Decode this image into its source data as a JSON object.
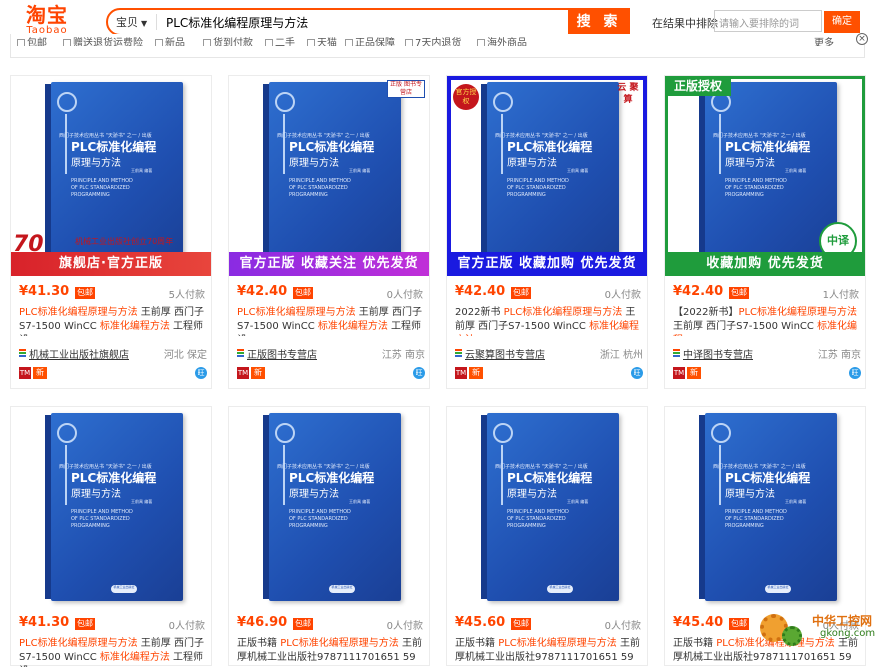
{
  "header": {
    "logo_zh": "淘宝",
    "logo_en": "Taobao",
    "search_category": "宝贝",
    "search_query": "PLC标准化编程原理与方法",
    "search_button": "搜 索",
    "exclude_label": "在结果中排除",
    "exclude_placeholder": "请输入要排除的词",
    "exclude_button": "确定",
    "close_symbol": "×"
  },
  "filters": {
    "items": [
      "包邮",
      "赠送退货运费险",
      "新品",
      "货到付款",
      "二手",
      "天猫",
      "正品保障",
      "7天内退货",
      "海外商品"
    ],
    "more": "更多"
  },
  "book": {
    "series": "西门子技术应用丛书 \"天骄书\" 之一 / 出版",
    "title": "PLC标准化编程",
    "subtitle": "原理与方法",
    "en_1": "PRINCIPLE AND METHOD",
    "en_2": "OF PLC STANDARDIZED",
    "en_3": "PROGRAMMING",
    "author": "王前禹 编著",
    "publisher": "机械工业出版社"
  },
  "products": [
    {
      "banner": "旗舰店·官方正版",
      "badge": "70",
      "badge_note": "机械工业出版社创立70周年",
      "price": "¥41.30",
      "baoyou": "包邮",
      "paid": "5人付款",
      "title_pre": "",
      "title_hl": "PLC标准化编程原理与方法",
      "title_mid": " 王前厚 西门子S7-1500 WinCC ",
      "title_hl2": "标准化编程方法",
      "title_post": " 工程师设",
      "shop": "机械工业出版社旗舰店",
      "location": "河北 保定",
      "tm": "TM",
      "new": "新",
      "ww": "旺"
    },
    {
      "banner": "官方正版 收藏关注 优先发货",
      "stamp": "正版 图书专营店",
      "price": "¥42.40",
      "baoyou": "包邮",
      "paid": "0人付款",
      "title_pre": "",
      "title_hl": "PLC标准化编程原理与方法",
      "title_mid": " 王前厚 西门子S7-1500 WinCC ",
      "title_hl2": "标准化编程方法",
      "title_post": " 工程师设",
      "shop": "正版图书专营店",
      "location": "江苏 南京",
      "tm": "TM",
      "new": "新",
      "ww": "旺"
    },
    {
      "banner": "官方正版 收藏加购 优先发货",
      "ribbon_left": "官方授权",
      "ribbon_right": "云 聚算",
      "price": "¥42.40",
      "baoyou": "包邮",
      "paid": "0人付款",
      "title_pre": "2022新书 ",
      "title_hl": "PLC标准化编程原理与方法",
      "title_mid": " 王前厚 西门子S7-1500 WinCC ",
      "title_hl2": "标准化编程方法",
      "title_post": "",
      "shop": "云聚算图书专营店",
      "location": "浙江 杭州",
      "tm": "TM",
      "new": "新",
      "ww": "旺"
    },
    {
      "banner": "收藏加购 优先发货",
      "tag": "正版授权",
      "seal": "中译",
      "price": "¥42.40",
      "baoyou": "包邮",
      "paid": "1人付款",
      "title_pre": "【2022新书】",
      "title_hl": "PLC标准化编程原理与方法",
      "title_mid": " 王前厚 西门子S7-1500 WinCC ",
      "title_hl2": "标准化编程",
      "title_post": "",
      "shop": "中译图书专营店",
      "location": "江苏 南京",
      "tm": "TM",
      "new": "新",
      "ww": "旺"
    },
    {
      "price": "¥41.30",
      "baoyou": "包邮",
      "paid": "0人付款",
      "title_pre": "",
      "title_hl": "PLC标准化编程原理与方法",
      "title_mid": " 王前厚 西门子S7-1500 WinCC ",
      "title_hl2": "标准化编程方法",
      "title_post": " 工程师设"
    },
    {
      "price": "¥46.90",
      "baoyou": "包邮",
      "paid": "0人付款",
      "title_pre": "正版书籍 ",
      "title_hl": "PLC标准化编程原理与方法",
      "title_mid": " 王前厚机械工业出版社9787111701651 59",
      "title_hl2": "",
      "title_post": ""
    },
    {
      "price": "¥45.60",
      "baoyou": "包邮",
      "paid": "0人付款",
      "title_pre": "正版书籍 ",
      "title_hl": "PLC标准化编程原理与方法",
      "title_mid": " 王前厚机械工业出版社9787111701651 59",
      "title_hl2": "",
      "title_post": ""
    },
    {
      "price": "¥45.40",
      "baoyou": "包邮",
      "paid": "0人付款",
      "title_pre": "正版书籍 ",
      "title_hl": "PLC标准化编程原理与方法",
      "title_mid": " 王前厚机械工业出版社9787111701651 59",
      "title_hl2": "",
      "title_post": ""
    }
  ],
  "watermark": {
    "text": "中华工控网",
    "url": "gkong.com"
  }
}
